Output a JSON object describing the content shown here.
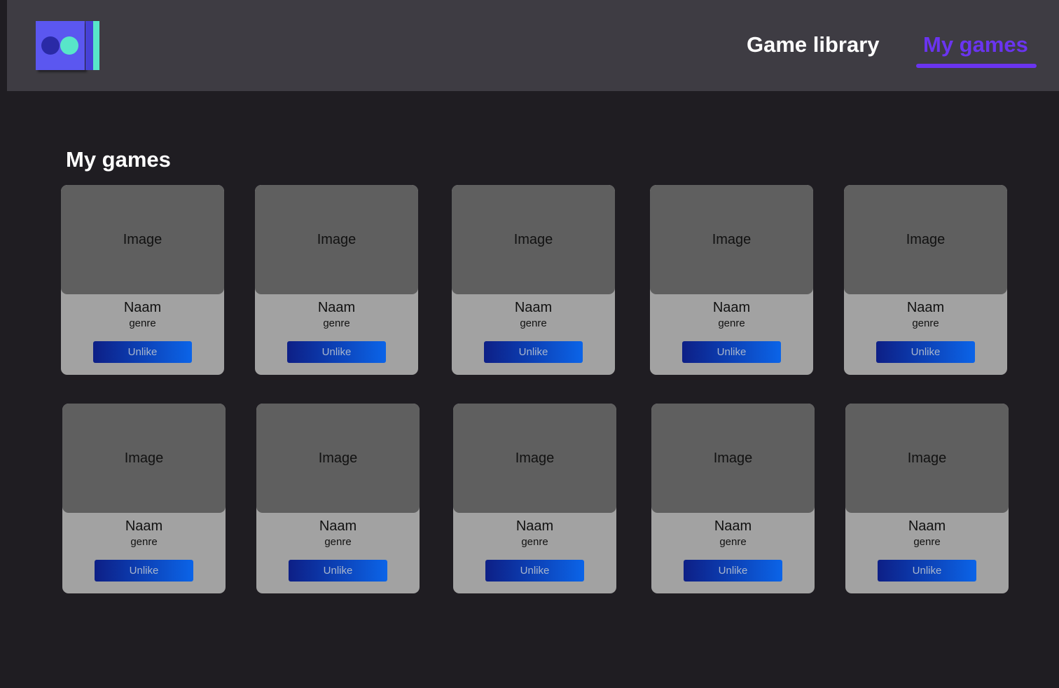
{
  "nav": {
    "logo_icon": "app-logo-icon",
    "items": [
      {
        "label": "Game library",
        "active": false
      },
      {
        "label": "My games",
        "active": true
      }
    ],
    "active_color": "#6a34f0"
  },
  "main": {
    "title": "My games"
  },
  "games": [
    {
      "image_label": "Image",
      "name": "Naam",
      "genre": "genre",
      "button": "Unlike"
    },
    {
      "image_label": "Image",
      "name": "Naam",
      "genre": "genre",
      "button": "Unlike"
    },
    {
      "image_label": "Image",
      "name": "Naam",
      "genre": "genre",
      "button": "Unlike"
    },
    {
      "image_label": "Image",
      "name": "Naam",
      "genre": "genre",
      "button": "Unlike"
    },
    {
      "image_label": "Image",
      "name": "Naam",
      "genre": "genre",
      "button": "Unlike"
    },
    {
      "image_label": "Image",
      "name": "Naam",
      "genre": "genre",
      "button": "Unlike"
    },
    {
      "image_label": "Image",
      "name": "Naam",
      "genre": "genre",
      "button": "Unlike"
    },
    {
      "image_label": "Image",
      "name": "Naam",
      "genre": "genre",
      "button": "Unlike"
    },
    {
      "image_label": "Image",
      "name": "Naam",
      "genre": "genre",
      "button": "Unlike"
    },
    {
      "image_label": "Image",
      "name": "Naam",
      "genre": "genre",
      "button": "Unlike"
    }
  ]
}
